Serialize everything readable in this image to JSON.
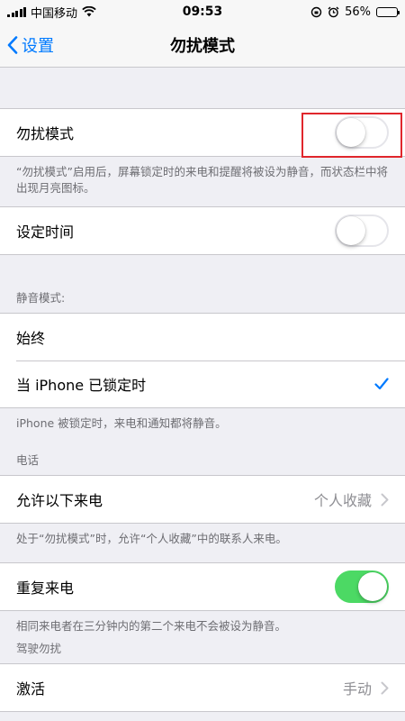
{
  "status_bar": {
    "carrier": "中国移动",
    "time": "09:53",
    "battery": "56%",
    "battery_level": 0.56
  },
  "nav": {
    "back_label": "设置",
    "title": "勿扰模式"
  },
  "dnd": {
    "label": "勿扰模式",
    "toggle_on": false,
    "footer": "“勿扰模式”启用后，屏幕锁定时的来电和提醒将被设为静音，而状态栏中将出现月亮图标。"
  },
  "scheduled": {
    "label": "设定时间",
    "toggle_on": false
  },
  "silence": {
    "header": "静音模式:",
    "options": [
      "始终",
      "当 iPhone 已锁定时"
    ],
    "selected_index": 1,
    "footer": "iPhone 被锁定时，来电和通知都将静音。"
  },
  "phone": {
    "header": "电话",
    "allow_calls_label": "允许以下来电",
    "allow_calls_value": "个人收藏",
    "allow_calls_footer": "处于“勿扰模式”时，允许“个人收藏”中的联系人来电。",
    "repeated_calls_label": "重复来电",
    "repeated_calls_on": true,
    "repeated_calls_footer": "相同来电者在三分钟内的第二个来电不会被设为静音。"
  },
  "driving": {
    "header": "驾驶勿扰",
    "activate_label": "激活",
    "activate_value": "手动"
  },
  "colors": {
    "accent": "#007aff",
    "toggle_on": "#4cd964",
    "highlight": "#e0262c"
  }
}
